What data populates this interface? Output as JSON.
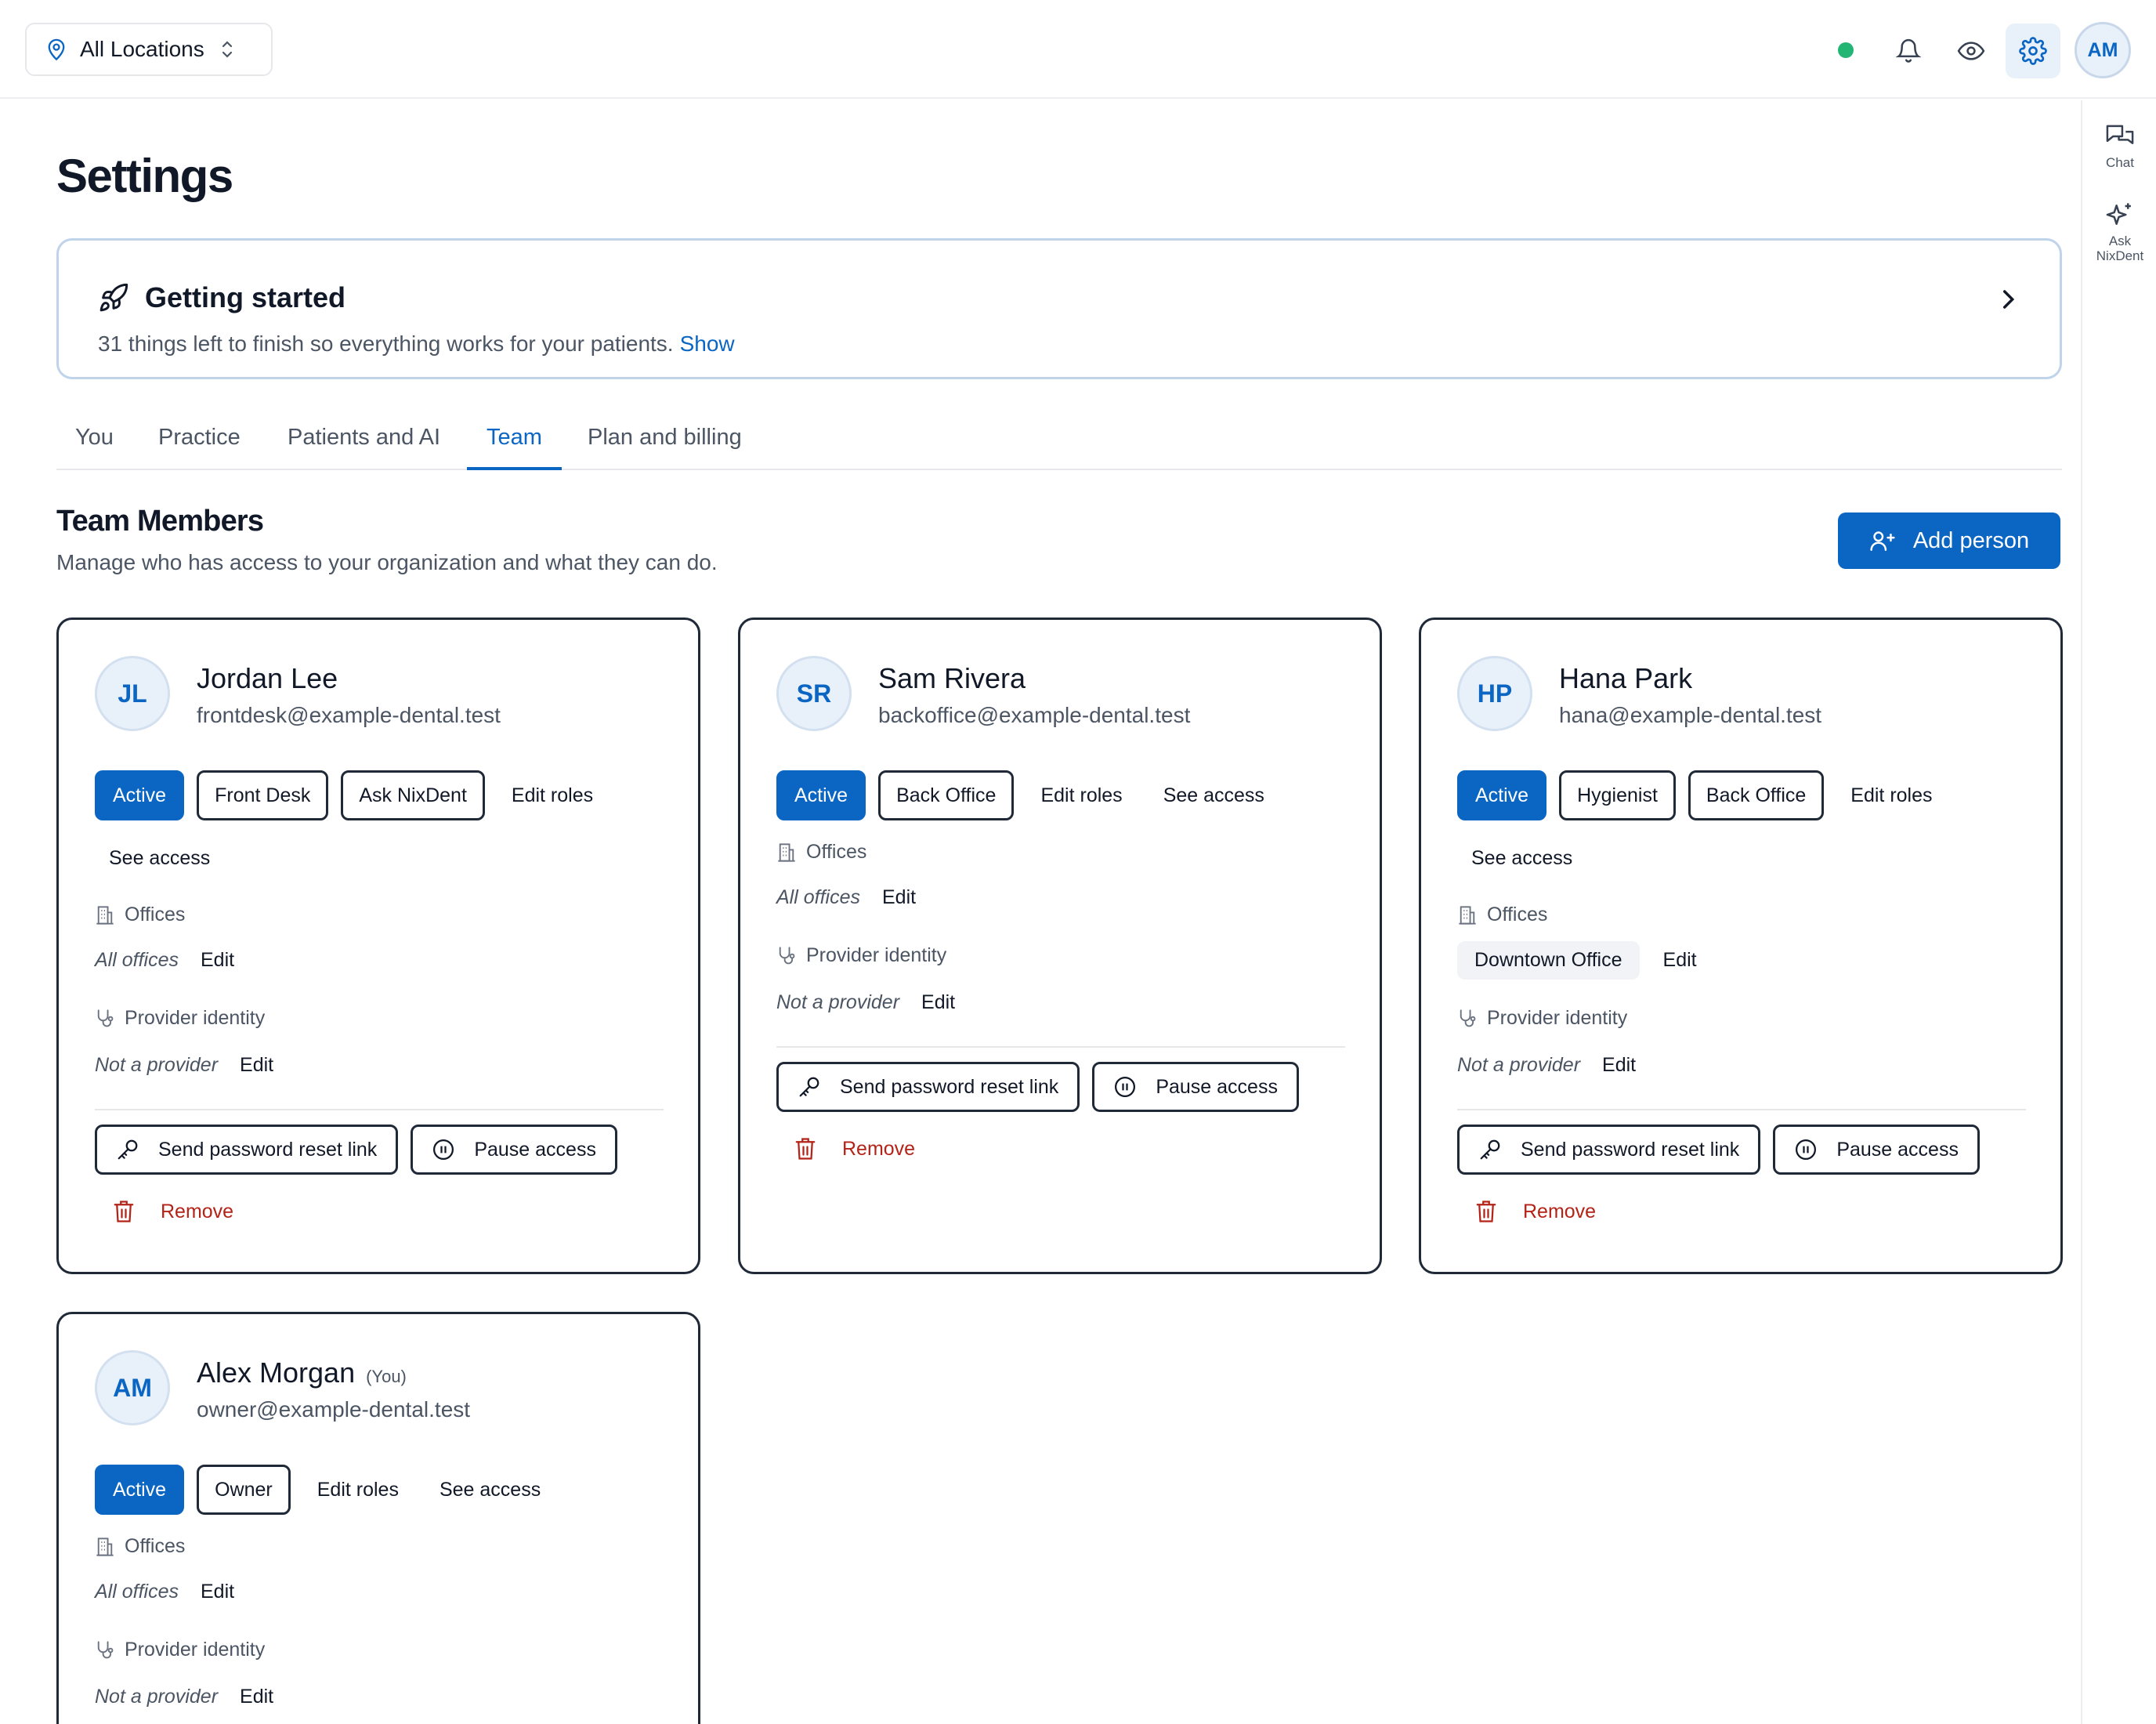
{
  "topbar": {
    "location_label": "All Locations",
    "user_initials": "AM",
    "status_color": "#22b573"
  },
  "rail": {
    "chat_label": "Chat",
    "ask_label_1": "Ask",
    "ask_label_2": "NixDent"
  },
  "page": {
    "title": "Settings"
  },
  "getting_started": {
    "title": "Getting started",
    "subtitle": "31 things left to finish so everything works for your patients.",
    "show_label": "Show"
  },
  "tabs": [
    "You",
    "Practice",
    "Patients and AI",
    "Team",
    "Plan and billing"
  ],
  "active_tab": "Team",
  "team": {
    "title": "Team Members",
    "subtitle": "Manage who has access to your organization and what they can do.",
    "add_label": "Add person"
  },
  "labels": {
    "offices": "Offices",
    "provider_identity": "Provider identity",
    "edit": "Edit",
    "edit_roles": "Edit roles",
    "see_access": "See access",
    "send_reset": "Send password reset link",
    "pause_access": "Pause access",
    "remove": "Remove",
    "you": "(You)"
  },
  "members": [
    {
      "initials": "JL",
      "name": "Jordan Lee",
      "email": "frontdesk@example-dental.test",
      "status": "Active",
      "roles": [
        "Front Desk",
        "Ask NixDent"
      ],
      "offices": "All offices",
      "provider": "Not a provider"
    },
    {
      "initials": "SR",
      "name": "Sam Rivera",
      "email": "backoffice@example-dental.test",
      "status": "Active",
      "roles": [
        "Back Office"
      ],
      "offices": "All offices",
      "provider": "Not a provider"
    },
    {
      "initials": "HP",
      "name": "Hana Park",
      "email": "hana@example-dental.test",
      "status": "Active",
      "roles": [
        "Hygienist",
        "Back Office"
      ],
      "offices": "Downtown Office",
      "provider": "Not a provider"
    },
    {
      "initials": "AM",
      "name": "Alex Morgan",
      "email": "owner@example-dental.test",
      "status": "Active",
      "roles": [
        "Owner"
      ],
      "offices": "All offices",
      "provider": "Not a provider"
    }
  ],
  "colors": {
    "accent": "#0a66c2",
    "danger": "#b42318",
    "border": "#1f2937"
  }
}
